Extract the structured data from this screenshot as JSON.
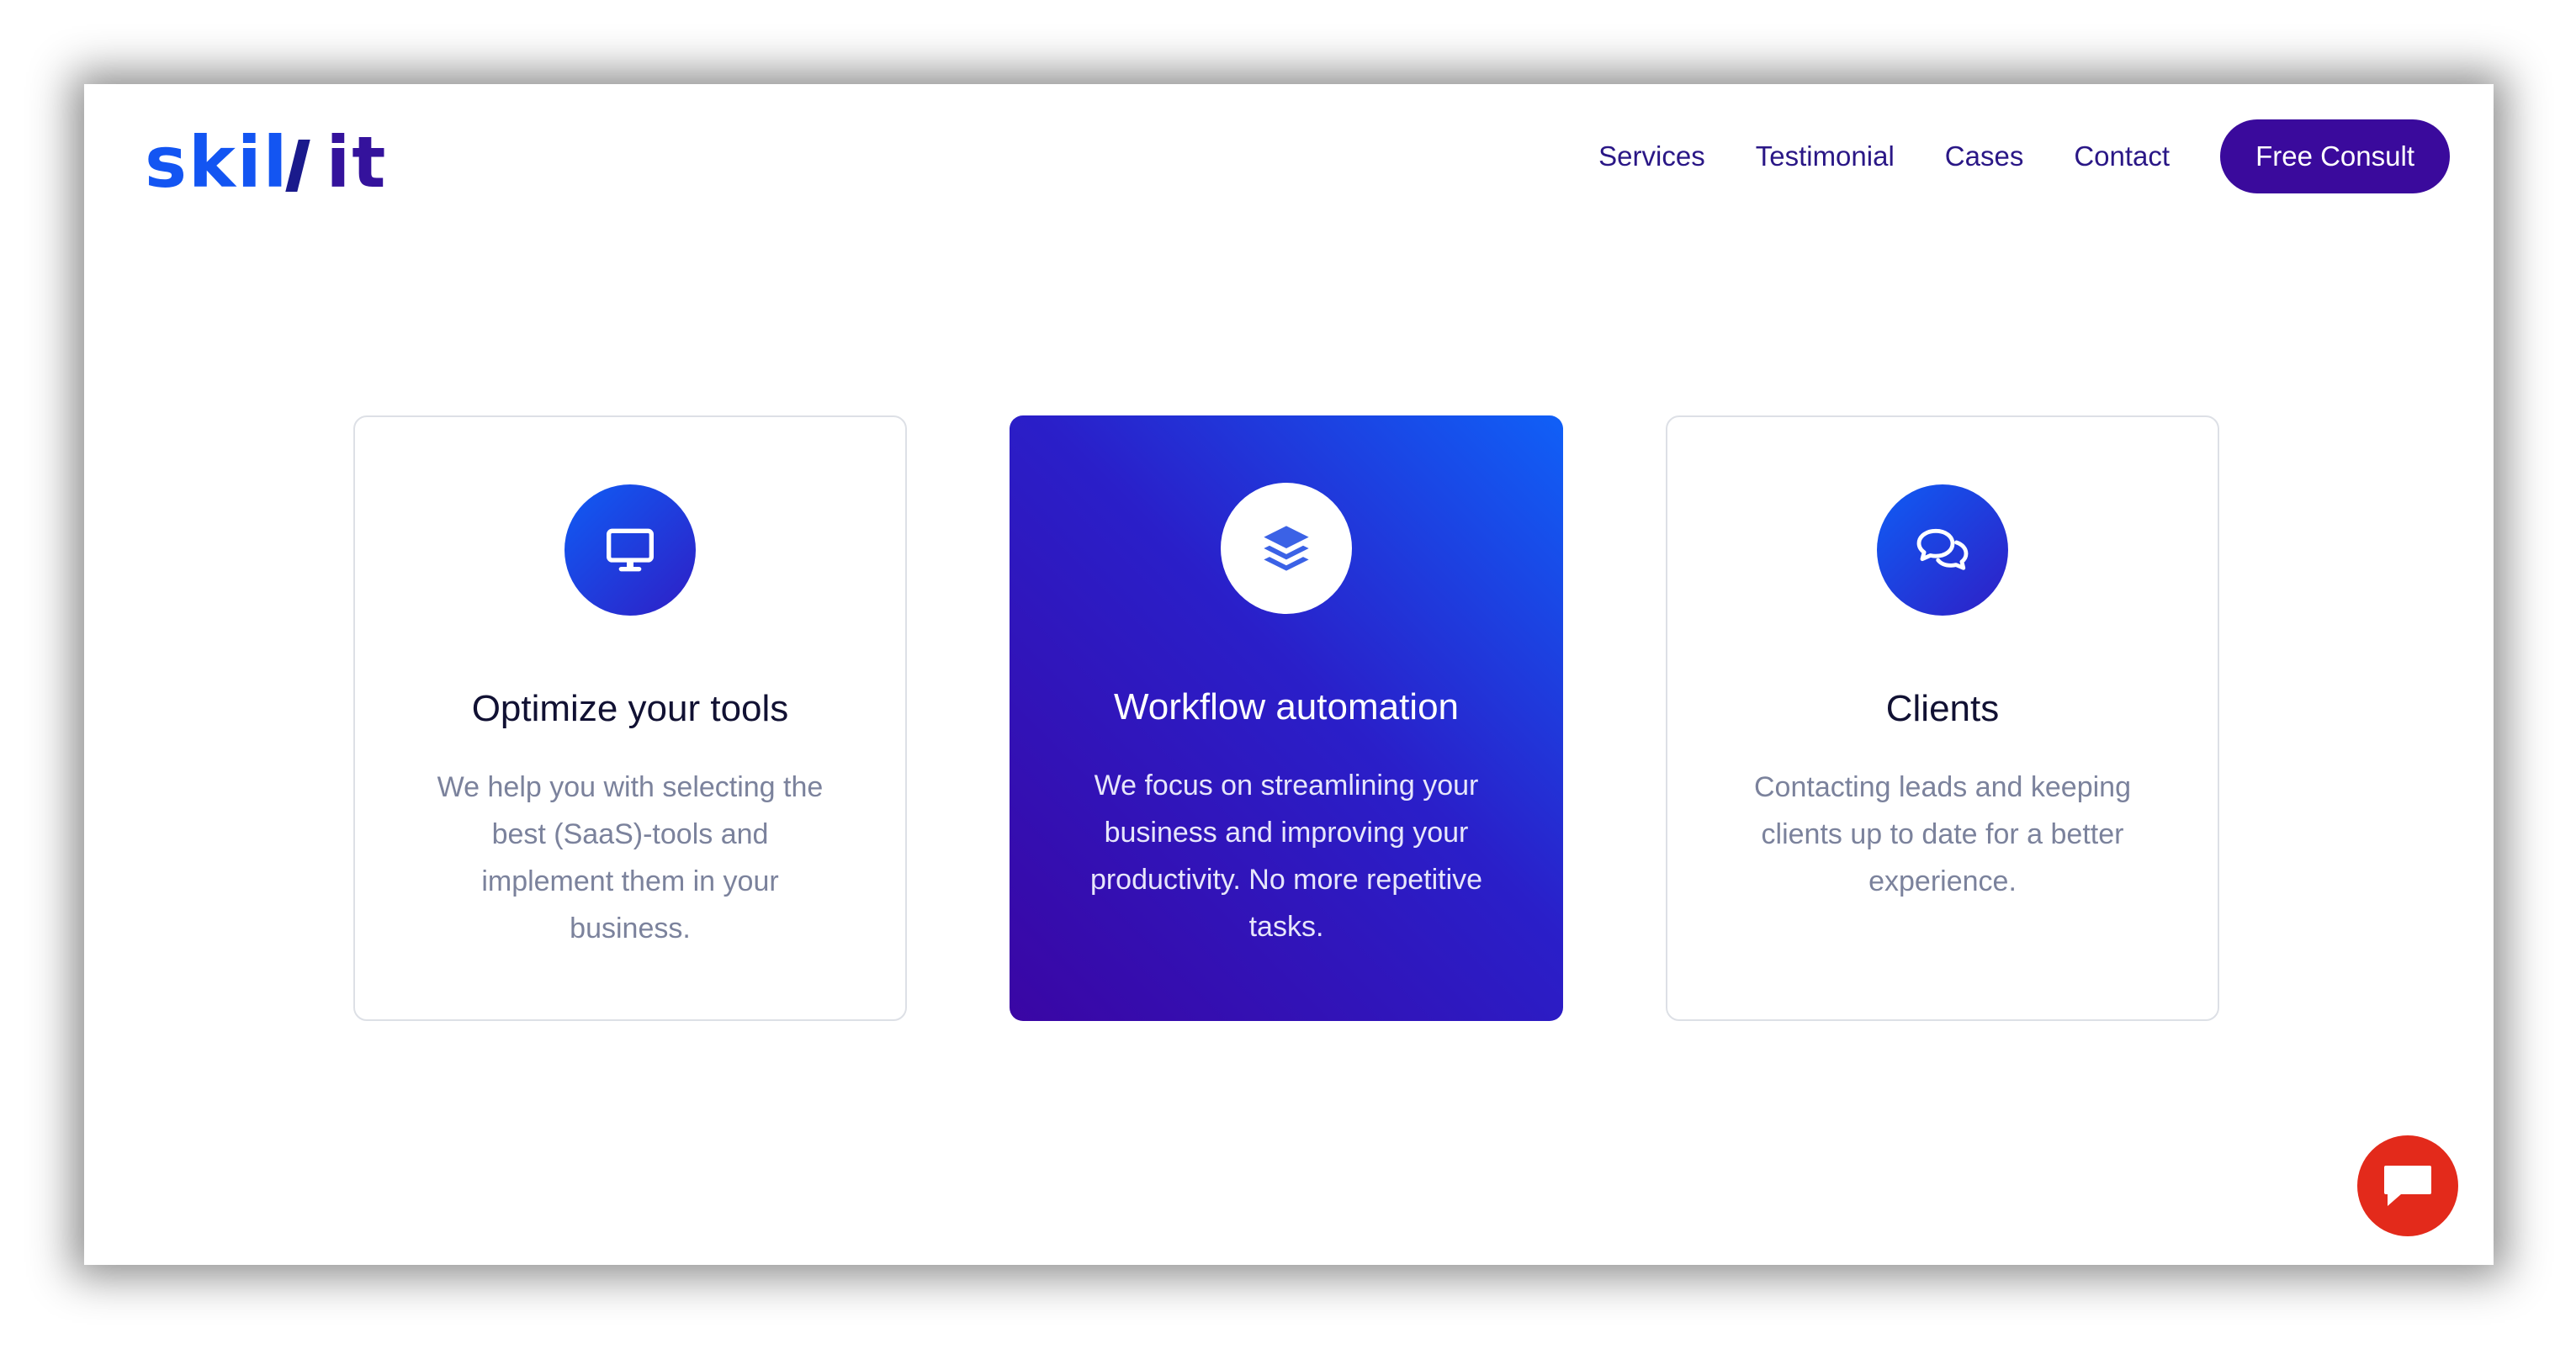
{
  "brand": {
    "logo_part1": "skil",
    "logo_part2": "it",
    "color_primary": "#1355f2",
    "color_secondary": "#34129c"
  },
  "nav": {
    "items": [
      {
        "label": "Services"
      },
      {
        "label": "Testimonial"
      },
      {
        "label": "Cases"
      },
      {
        "label": "Contact"
      }
    ],
    "cta_label": "Free Consult"
  },
  "cards": [
    {
      "icon": "monitor-icon",
      "title": "Optimize your tools",
      "description": "We help you with selecting the best (SaaS)-tools and implement them in your business.",
      "highlighted": false
    },
    {
      "icon": "layers-icon",
      "title": "Workflow automation",
      "description": "We focus on streamlining your business and improving your productivity. No more repetitive tasks.",
      "highlighted": true
    },
    {
      "icon": "chat-bubbles-icon",
      "title": "Clients",
      "description": "Contacting leads and keeping clients up to date for a better experience.",
      "highlighted": false
    }
  ],
  "chat_widget": {
    "icon": "chat-icon",
    "color": "#e32a1b"
  },
  "colors": {
    "accent_gradient_start": "#1060f7",
    "accent_gradient_end": "#3a06a4",
    "cta_background": "#3a0a9c",
    "body_text": "#7b829c"
  }
}
